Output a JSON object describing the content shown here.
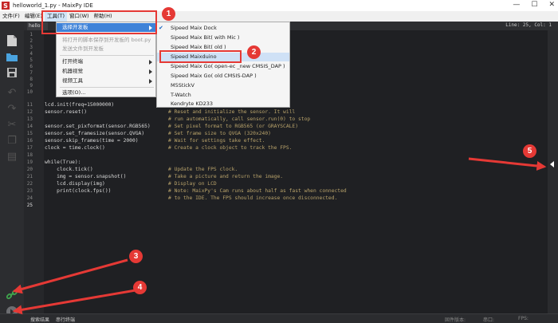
{
  "window": {
    "title": "helloworld_1.py - MaixPy IDE",
    "controls": [
      "—",
      "☐",
      "✕"
    ]
  },
  "menubar": [
    "文件(F)",
    "编辑(E)",
    "工具(T)",
    "窗口(W)",
    "帮助(H)"
  ],
  "tab": {
    "label": "hello"
  },
  "position": "Line: 25, Col: 1",
  "tools_menu": {
    "items": [
      {
        "label": "选择开发板",
        "submenu": true,
        "highlighted": true
      },
      {
        "label": "将打开的脚本保存到开发板的 boot.py",
        "disabled": true
      },
      {
        "label": "发送文件到开发板",
        "disabled": true
      },
      {
        "label": "打开终端",
        "submenu": true
      },
      {
        "label": "机器视觉",
        "submenu": true
      },
      {
        "label": "视频工具",
        "submenu": true
      },
      {
        "label": "选项(O)..."
      }
    ]
  },
  "board_menu": {
    "items": [
      {
        "label": "Sipeed Maix Dock",
        "checked": true
      },
      {
        "label": "Sipeed Maix Bit( with Mic )"
      },
      {
        "label": "Sipeed Maix Bit( old )"
      },
      {
        "label": "Sipeed Maixduino",
        "selected": true
      },
      {
        "label": "Sipeed Maix Go( open-ec _new CMSIS_DAP )"
      },
      {
        "label": "Sipeed Maix Go( old CMSIS-DAP )"
      },
      {
        "label": "M5StickV"
      },
      {
        "label": "T-Watch"
      },
      {
        "label": "Kendryte KD233"
      }
    ]
  },
  "code": {
    "line_numbers": [
      "1",
      "2",
      "3",
      "4",
      "5",
      "6",
      "7",
      "8",
      "9",
      "10",
      "11",
      "12",
      "13",
      "14",
      "15",
      "16",
      "17",
      "18",
      "19",
      "20",
      "21",
      "22",
      "23",
      "24",
      "25"
    ],
    "lines": [
      {
        "num": "11",
        "code": "lcd.init(freq=15000000)",
        "comment": ""
      },
      {
        "num": "12",
        "code": "sensor.reset()",
        "comment": "# Reset and initialize the sensor. It will"
      },
      {
        "num": "13",
        "code": "",
        "comment": "# run automatically, call sensor.run(0) to stop"
      },
      {
        "num": "14",
        "code": "sensor.set_pixformat(sensor.RGB565)",
        "comment": "# Set pixel format to RGB565 (or GRAYSCALE)"
      },
      {
        "num": "15",
        "code": "sensor.set_framesize(sensor.QVGA)",
        "comment": "# Set frame size to QVGA (320x240)"
      },
      {
        "num": "16",
        "code": "sensor.skip_frames(time = 2000)",
        "comment": "# Wait for settings take effect."
      },
      {
        "num": "17",
        "code": "clock = time.clock()",
        "comment": "# Create a clock object to track the FPS."
      },
      {
        "num": "18",
        "code": "",
        "comment": ""
      },
      {
        "num": "19",
        "code": "while(True):",
        "comment": ""
      },
      {
        "num": "20",
        "code": "    clock.tick()",
        "comment": "# Update the FPS clock."
      },
      {
        "num": "21",
        "code": "    img = sensor.snapshot()",
        "comment": "# Take a picture and return the image."
      },
      {
        "num": "22",
        "code": "    lcd.display(img)",
        "comment": "# Display on LCD"
      },
      {
        "num": "23",
        "code": "    print(clock.fps())",
        "comment": "# Note: MaixPy's Cam runs about half as fast when connected"
      },
      {
        "num": "24",
        "code": "",
        "comment": "# to the IDE. The FPS should increase once disconnected."
      },
      {
        "num": "25",
        "code": "",
        "comment": ""
      }
    ]
  },
  "statusbar": {
    "search_results": "搜索结果",
    "serial_terminal": "串行终端",
    "serial_port": "固件版本:",
    "fw_version": "串口:",
    "fps": "FPS:"
  },
  "annotations": [
    "1",
    "2",
    "3",
    "4",
    "5"
  ],
  "colors": {
    "annotation": "#e53935",
    "menu_highlight": "#3e82d8",
    "connect_icon": "#3fa34d",
    "comment": "#b8a26a"
  }
}
